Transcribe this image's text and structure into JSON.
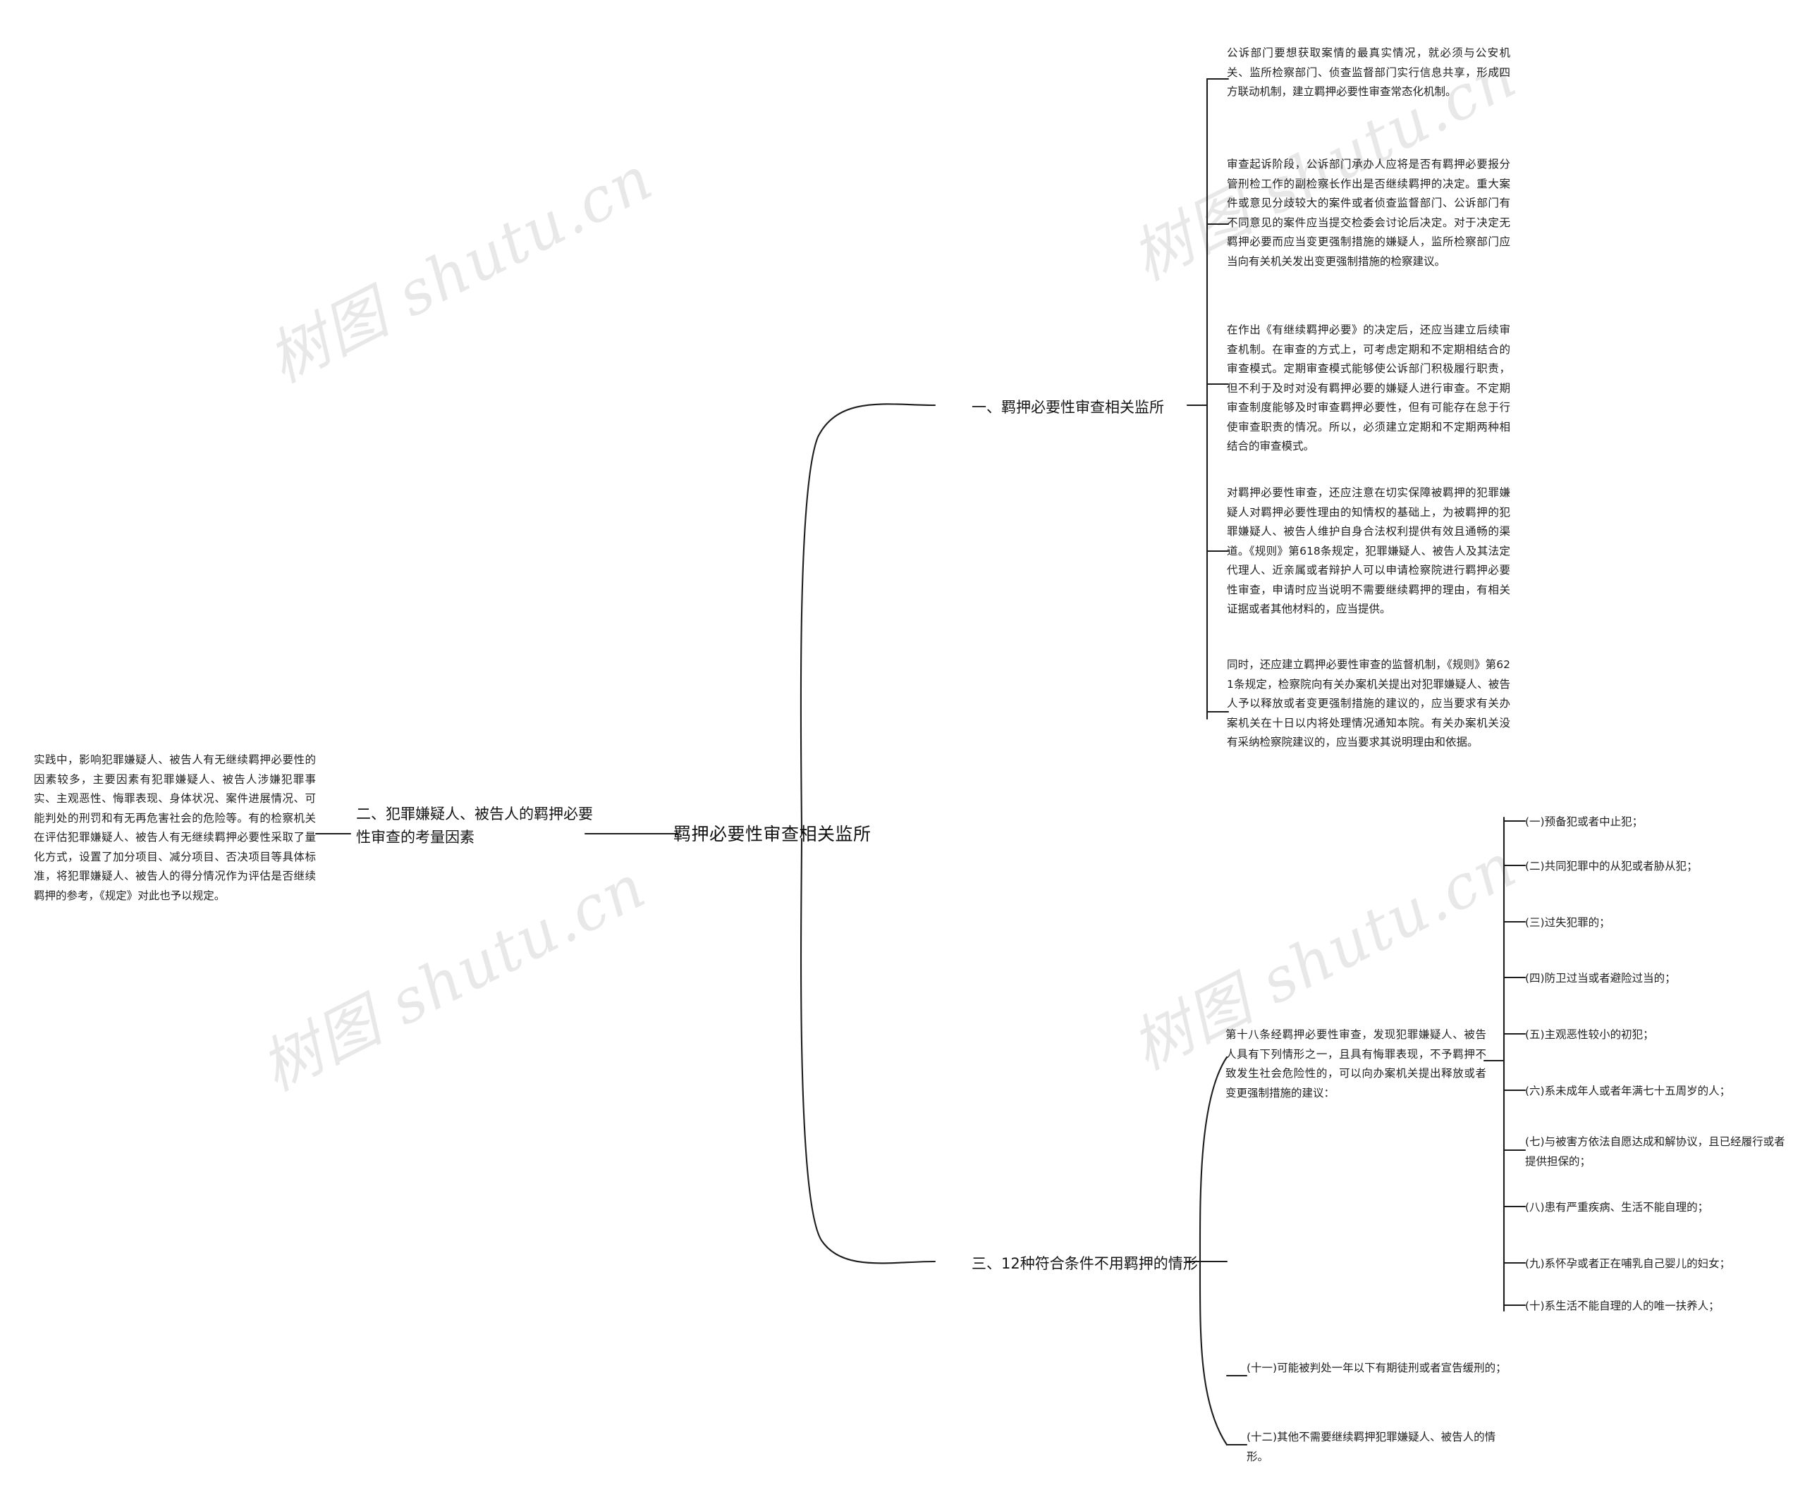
{
  "document": {
    "type": "mindmap",
    "root_label": "羁押必要性审查相关监所",
    "watermark_text": "树图 shutu.cn"
  },
  "root": {
    "label": "羁押必要性审查相关监所"
  },
  "branches": [
    {
      "id": "branch-1",
      "label": "一、羁押必要性审查相关监所",
      "children": [
        {
          "id": "b1-c1",
          "text": "公诉部门要想获取案情的最真实情况，就必须与公安机关、监所检察部门、侦查监督部门实行信息共享，形成四方联动机制，建立羁押必要性审查常态化机制。"
        },
        {
          "id": "b1-c2",
          "text": "审查起诉阶段，公诉部门承办人应将是否有羁押必要报分管刑检工作的副检察长作出是否继续羁押的决定。重大案件或意见分歧较大的案件或者侦查监督部门、公诉部门有不同意见的案件应当提交检委会讨论后决定。对于决定无羁押必要而应当变更强制措施的嫌疑人，监所检察部门应当向有关机关发出变更强制措施的检察建议。"
        },
        {
          "id": "b1-c3",
          "text": "在作出《有继续羁押必要》的决定后，还应当建立后续审查机制。在审查的方式上，可考虑定期和不定期相结合的审查模式。定期审查模式能够使公诉部门积极履行职责，但不利于及时对没有羁押必要的嫌疑人进行审查。不定期审查制度能够及时审查羁押必要性，但有可能存在怠于行使审查职责的情况。所以，必须建立定期和不定期两种相结合的审查模式。"
        },
        {
          "id": "b1-c4",
          "text": "对羁押必要性审查，还应注意在切实保障被羁押的犯罪嫌疑人对羁押必要性理由的知情权的基础上，为被羁押的犯罪嫌疑人、被告人维护自身合法权利提供有效且通畅的渠道。《规则》第618条规定，犯罪嫌疑人、被告人及其法定代理人、近亲属或者辩护人可以申请检察院进行羁押必要性审查，申请时应当说明不需要继续羁押的理由，有相关证据或者其他材料的，应当提供。"
        },
        {
          "id": "b1-c5",
          "text": "同时，还应建立羁押必要性审查的监督机制，《规则》第621条规定，检察院向有关办案机关提出对犯罪嫌疑人、被告人予以释放或者变更强制措施的建议的，应当要求有关办案机关在十日以内将处理情况通知本院。有关办案机关没有采纳检察院建议的，应当要求其说明理由和依据。"
        }
      ]
    },
    {
      "id": "branch-2",
      "label": "二、犯罪嫌疑人、被告人的羁押必要性审查的考量因素",
      "children": [
        {
          "id": "b2-c1",
          "text": "实践中，影响犯罪嫌疑人、被告人有无继续羁押必要性的因素较多，主要因素有犯罪嫌疑人、被告人涉嫌犯罪事实、主观恶性、悔罪表现、身体状况、案件进展情况、可能判处的刑罚和有无再危害社会的危险等。有的检察机关在评估犯罪嫌疑人、被告人有无继续羁押必要性采取了量化方式，设置了加分项目、减分项目、否决项目等具体标准，将犯罪嫌疑人、被告人的得分情况作为评估是否继续羁押的参考，《规定》对此也予以规定。"
        }
      ]
    },
    {
      "id": "branch-3",
      "label": "三、12种符合条件不用羁押的情形",
      "children": [
        {
          "id": "b3-intro",
          "text": "第十八条经羁押必要性审查，发现犯罪嫌疑人、被告人具有下列情形之一，且具有悔罪表现，不予羁押不致发生社会危险性的，可以向办案机关提出释放或者变更强制措施的建议："
        }
      ],
      "items": [
        {
          "id": "item-1",
          "text": "(一)预备犯或者中止犯；"
        },
        {
          "id": "item-2",
          "text": "(二)共同犯罪中的从犯或者胁从犯；"
        },
        {
          "id": "item-3",
          "text": "(三)过失犯罪的；"
        },
        {
          "id": "item-4",
          "text": "(四)防卫过当或者避险过当的；"
        },
        {
          "id": "item-5",
          "text": "(五)主观恶性较小的初犯；"
        },
        {
          "id": "item-6",
          "text": "(六)系未成年人或者年满七十五周岁的人；"
        },
        {
          "id": "item-7",
          "text": "(七)与被害方依法自愿达成和解协议，且已经履行或者提供担保的；"
        },
        {
          "id": "item-8",
          "text": "(八)患有严重疾病、生活不能自理的；"
        },
        {
          "id": "item-9",
          "text": "(九)系怀孕或者正在哺乳自己婴儿的妇女；"
        },
        {
          "id": "item-10",
          "text": "(十)系生活不能自理的人的唯一扶养人；"
        },
        {
          "id": "item-11",
          "text": "(十一)可能被判处一年以下有期徒刑或者宣告缓刑的；"
        },
        {
          "id": "item-12",
          "text": "(十二)其他不需要继续羁押犯罪嫌疑人、被告人的情形。"
        }
      ]
    }
  ],
  "colors": {
    "background": "#ffffff",
    "text": "#1a1a1a",
    "line": "#1d1d1d",
    "watermark": "#e3e3e3"
  }
}
